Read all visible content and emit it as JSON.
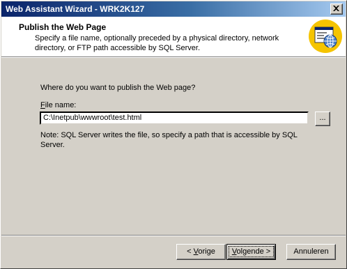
{
  "window": {
    "title": "Web Assistant Wizard - WRK2K127"
  },
  "header": {
    "title": "Publish the Web Page",
    "description": "Specify a file name, optionally preceded by a physical directory, network directory, or FTP path accessible by SQL Server.",
    "icon": "web-page-globe-icon"
  },
  "main": {
    "question": "Where do you want to publish the Web page?",
    "file_label_accel": "F",
    "file_label_rest": "ile name:",
    "file_value": "C:\\Inetpub\\wwwroot\\test.html",
    "browse_label": "...",
    "note": "Note: SQL Server writes the file, so specify a path that is accessible by SQL Server."
  },
  "buttons": {
    "back_prefix": "< ",
    "back_accel": "V",
    "back_rest": "orige",
    "next_accel": "V",
    "next_rest": "olgende >",
    "cancel": "Annuleren"
  },
  "colors": {
    "titlebar_start": "#0a246a",
    "titlebar_end": "#a6caf0",
    "dialog_face": "#d4d0c8",
    "icon_yellow": "#f5c400"
  }
}
